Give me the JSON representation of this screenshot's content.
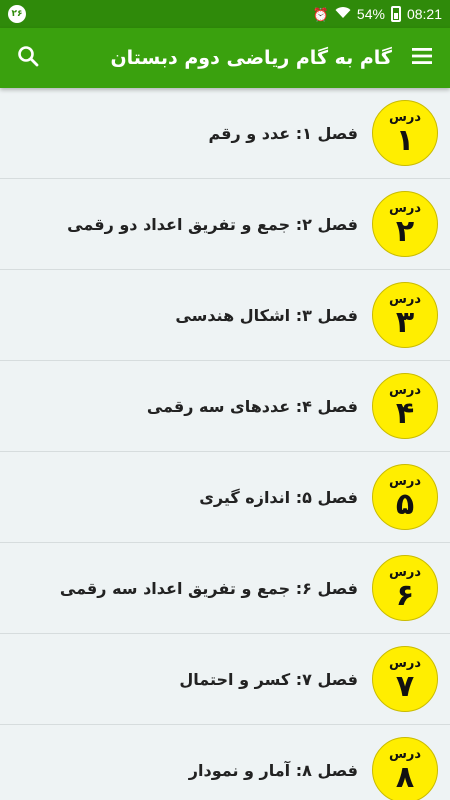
{
  "status_bar": {
    "notification_badge": "۲۶",
    "battery": "54%",
    "time": "08:21"
  },
  "app_bar": {
    "title": "گام به گام ریاضی دوم دبستان"
  },
  "lessons": [
    {
      "badge_label": "درس",
      "badge_number": "۱",
      "title": "فصل ۱: عدد و رقم"
    },
    {
      "badge_label": "درس",
      "badge_number": "۲",
      "title": "فصل ۲: جمع و تفریق اعداد دو رقمی"
    },
    {
      "badge_label": "درس",
      "badge_number": "۳",
      "title": "فصل ۳: اشکال هندسی"
    },
    {
      "badge_label": "درس",
      "badge_number": "۴",
      "title": "فصل ۴: عددهای سه رقمی"
    },
    {
      "badge_label": "درس",
      "badge_number": "۵",
      "title": "فصل ۵: اندازه گیری"
    },
    {
      "badge_label": "درس",
      "badge_number": "۶",
      "title": "فصل ۶: جمع و تفریق اعداد سه رقمی"
    },
    {
      "badge_label": "درس",
      "badge_number": "۷",
      "title": "فصل ۷: کسر و احتمال"
    },
    {
      "badge_label": "درس",
      "badge_number": "۸",
      "title": "فصل ۸: آمار و نمودار"
    }
  ],
  "colors": {
    "status_bar": "#2f8a0a",
    "app_bar": "#3aa10e",
    "badge": "#ffee00",
    "background": "#eef3f4"
  },
  "icons": [
    "search-icon",
    "menu-icon",
    "wifi-icon",
    "alarm-icon",
    "battery-icon"
  ]
}
